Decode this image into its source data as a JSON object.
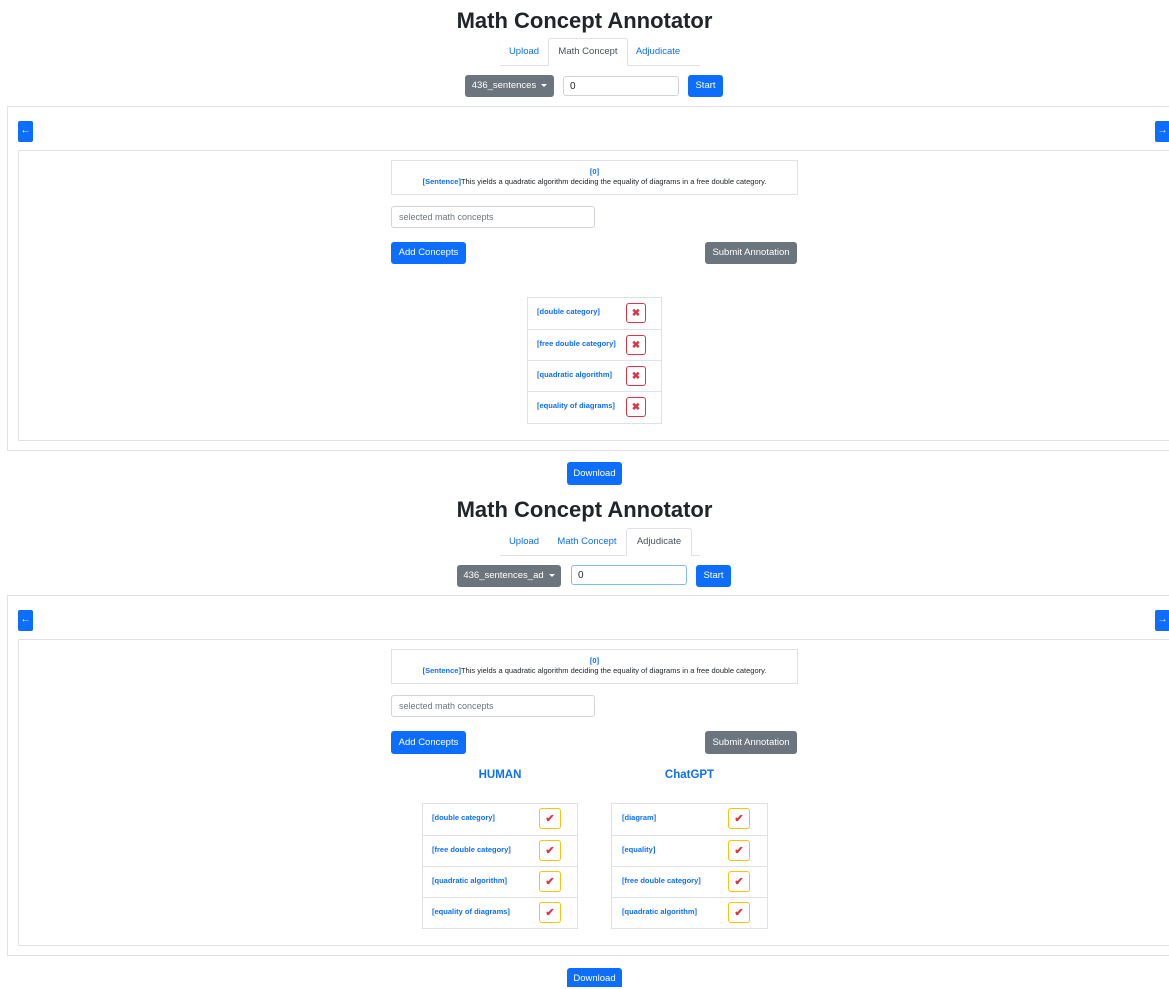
{
  "app_title": "Math Concept Annotator",
  "tabs": [
    "Upload",
    "Math Concept",
    "Adjudicate"
  ],
  "colors": {
    "primary": "#0d6efd",
    "secondary": "#6c757d",
    "danger": "#dc3545",
    "warning": "#ffc107"
  },
  "icons": {
    "prev": "arrow-left-icon",
    "next": "arrow-right-icon",
    "remove": "x-icon",
    "accept": "check-icon"
  },
  "panel1": {
    "active_tab": "Math Concept",
    "dataset": "436_sentences",
    "index_value": "0",
    "start_label": "Start",
    "sentence_index": "[0]",
    "sentence_tag": "[Sentence]",
    "sentence_text": "This yields a quadratic algorithm deciding the equality of diagrams in a free double category.",
    "concepts_placeholder": "selected math concepts",
    "add_label": "Add Concepts",
    "submit_label": "Submit Annotation",
    "concepts": [
      "[double category]",
      "[free double category]",
      "[quadratic algorithm]",
      "[equality of diagrams]"
    ],
    "remove_symbol": "✖",
    "download_label": "Download"
  },
  "panel2": {
    "active_tab": "Adjudicate",
    "dataset": "436_sentences_ad",
    "index_value": "0",
    "start_label": "Start",
    "sentence_index": "[0]",
    "sentence_tag": "[Sentence]",
    "sentence_text": "This yields a quadratic algorithm deciding the equality of diagrams in a free double category.",
    "concepts_placeholder": "selected math concepts",
    "add_label": "Add Concepts",
    "submit_label": "Submit Annotation",
    "human_heading": "HUMAN",
    "chatgpt_heading": "ChatGPT",
    "human_concepts": [
      "[double category]",
      "[free double category]",
      "[quadratic algorithm]",
      "[equality of diagrams]"
    ],
    "chatgpt_concepts": [
      "[diagram]",
      "[equality]",
      "[free double category]",
      "[quadratic algorithm]"
    ],
    "check_symbol": "✔",
    "download_label": "Download"
  }
}
